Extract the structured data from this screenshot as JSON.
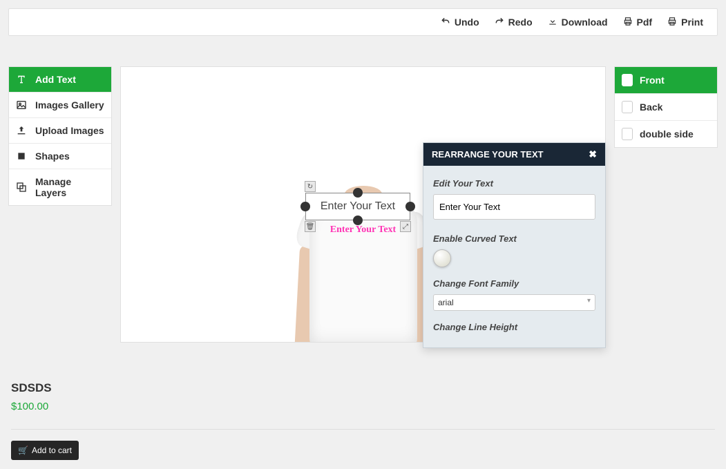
{
  "topbar": {
    "undo": "Undo",
    "redo": "Redo",
    "download": "Download",
    "pdf": "Pdf",
    "print": "Print"
  },
  "sidebar_left": {
    "add_text": "Add Text",
    "images_gallery": "Images Gallery",
    "upload_images": "Upload Images",
    "shapes": "Shapes",
    "manage_layers": "Manage Layers"
  },
  "canvas": {
    "pink_text": "Enter Your Text",
    "selection_text": "Enter Your Text"
  },
  "panel": {
    "title": "REARRANGE YOUR TEXT",
    "edit_label": "Edit Your Text",
    "edit_value": "Enter Your Text",
    "curved_label": "Enable Curved Text",
    "font_label": "Change Font Family",
    "font_value": "arial",
    "lineheight_label": "Change Line Height"
  },
  "sidebar_right": {
    "front": "Front",
    "back": "Back",
    "double": "double side"
  },
  "product": {
    "name": "SDSDS",
    "price": "$100.00",
    "add_to_cart": "Add to cart"
  }
}
